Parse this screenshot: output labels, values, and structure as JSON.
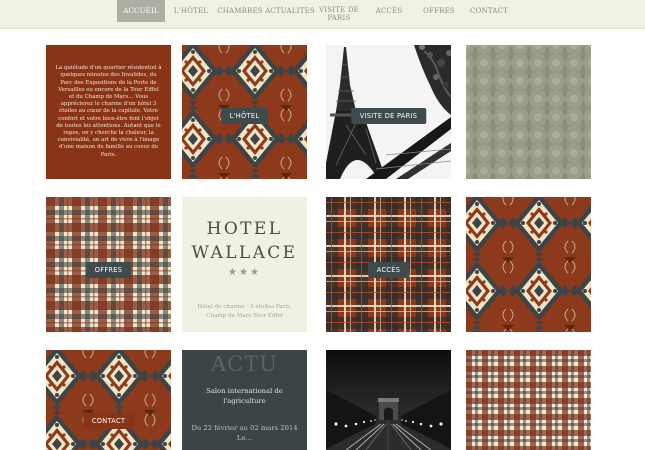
{
  "nav": {
    "items": [
      {
        "label": "ACCUEIL"
      },
      {
        "label": "L'HÔTEL"
      },
      {
        "label": "CHAMBRES"
      },
      {
        "label": "ACTUALITES"
      },
      {
        "label": "VISITE DE PARIS"
      },
      {
        "label": "ACCÈS"
      },
      {
        "label": "OFFRES"
      },
      {
        "label": "CONTACT"
      }
    ],
    "language_icon": "uk-flag-icon"
  },
  "intro": {
    "text": "La quiétude d'un quartier résidentiel à quelques minutes des Invalides, du Parc des Expositions de la Porte de Versailles ou encore de la Tour Eiffel et du Champ de Mars… Vous apprécierez le charme d'un hôtel 3 étoiles au cœur de la capitale. Votre confort et votre bien-être font l'objet de toutes les attentions. Autant que le repos, on y cherche la chaleur, la convivialité, un art de vivre à l'image d'une maison de famille au coeur de Paris."
  },
  "tiles": {
    "hotel_label": "L'HÔTEL",
    "paris_label": "VISITE DE PARIS",
    "offres_label": "OFFRES",
    "acces_label": "ACCÈS",
    "contact_label": "CONTACT"
  },
  "hotel_card": {
    "line1": "HOTEL",
    "line2": "WALLACE",
    "stars": "★★★",
    "subtitle": "Hôtel de charme · 3 étoiles Paris, Champ de Mars Tour Eiffel"
  },
  "actu": {
    "title": "ACTU",
    "headline": "Salon international de l'agriculture",
    "date": "Du 22 février au 02 mars 2014",
    "more": "Le…"
  },
  "colors": {
    "brick": "#8a3417",
    "slate": "#3f4a4e",
    "cream": "#f1f1e3",
    "nav_bg": "#f1f1e4"
  }
}
